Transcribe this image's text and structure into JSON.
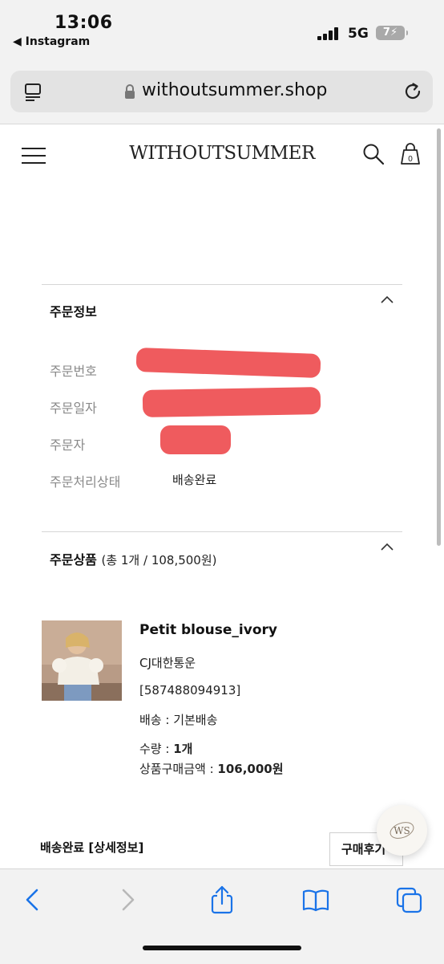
{
  "status_bar": {
    "time": "13:06",
    "back_app": "◀ Instagram",
    "network": "5G",
    "battery": "7"
  },
  "browser": {
    "url": "withoutsummer.shop"
  },
  "site": {
    "logo": "WITHOUTSUMMER",
    "cart_count": "0"
  },
  "order_info": {
    "title": "주문정보",
    "rows": [
      {
        "label": "주문번호",
        "value": ""
      },
      {
        "label": "주문일자",
        "value": ""
      },
      {
        "label": "주문자",
        "value": ""
      },
      {
        "label": "주문처리상태",
        "value": "배송완료"
      }
    ]
  },
  "order_items": {
    "title": "주문상품",
    "summary": "(총 1개 / 108,500원)",
    "product": {
      "name": "Petit blouse_ivory",
      "courier": "CJ대한통운",
      "tracking": "[587488094913]",
      "shipping": "배송 : 기본배송",
      "qty_label": "수량 : ",
      "qty_value": "1개",
      "price_label": "상품구매금액 : ",
      "price_value": "106,000원"
    }
  },
  "delivery": {
    "title": "배송완료 [상세정보]",
    "review_button": "구매후기"
  },
  "badge": {
    "text": "WS"
  },
  "colors": {
    "redaction": "#ee4d50",
    "browser_chrome": "#f2f2f2",
    "accent_blue": "#1a73e8"
  }
}
